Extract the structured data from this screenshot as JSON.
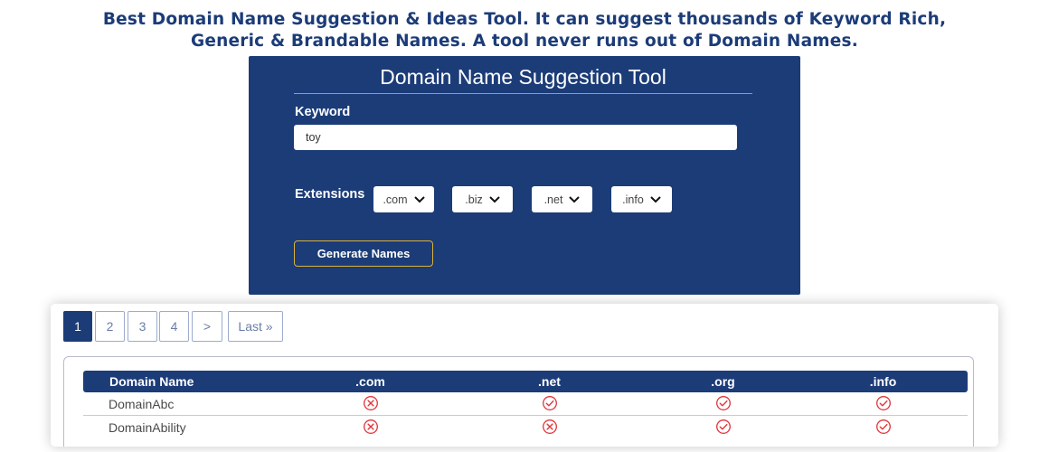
{
  "intro": {
    "line1": "Best Domain Name Suggestion & Ideas Tool. It can suggest thousands of Keyword Rich,",
    "line2": "Generic & Brandable Names. A tool never runs out of Domain Names."
  },
  "tool": {
    "title": "Domain Name Suggestion Tool",
    "keyword_label": "Keyword",
    "keyword_value": "toy",
    "extensions_label": "Extensions",
    "extensions": [
      ".com",
      ".biz",
      ".net",
      ".info"
    ],
    "generate_label": "Generate Names"
  },
  "pagination": {
    "pages": [
      "1",
      "2",
      "3",
      "4"
    ],
    "active_page": "1",
    "next_label": ">",
    "last_label": "Last »"
  },
  "results": {
    "headers": [
      "Domain Name",
      ".com",
      ".net",
      ".org",
      ".info"
    ],
    "rows": [
      {
        "name": "DomainAbc",
        "status": [
          "taken",
          "available",
          "available",
          "available"
        ]
      },
      {
        "name": "DomainAbility",
        "status": [
          "taken",
          "taken",
          "available",
          "available"
        ]
      }
    ]
  },
  "colors": {
    "brand_navy": "#1c3c78",
    "button_border_gold": "#d9b13b",
    "status_red": "#e0343a"
  },
  "icons": {
    "available": "check-circle-icon",
    "taken": "x-circle-icon",
    "dropdown": "chevron-down-icon"
  }
}
